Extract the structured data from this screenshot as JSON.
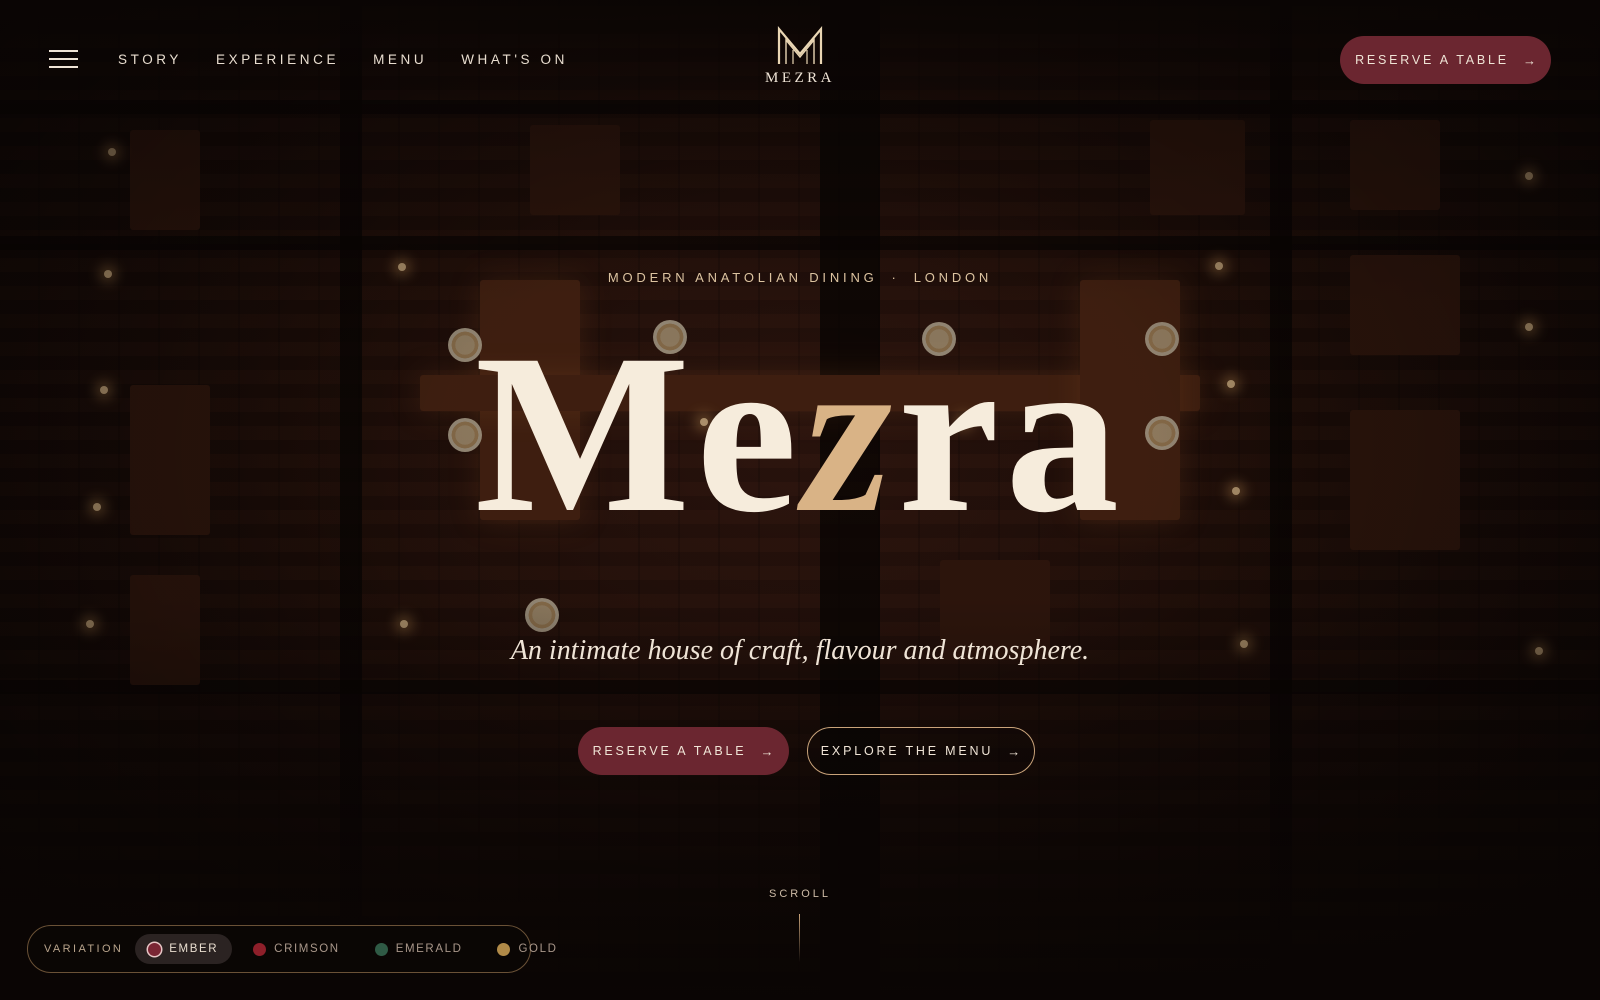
{
  "header": {
    "nav": [
      "STORY",
      "EXPERIENCE",
      "MENU",
      "WHAT'S ON"
    ],
    "brand": "MEZRA",
    "cta_label": "RESERVE A TABLE"
  },
  "hero": {
    "eyebrow_left": "MODERN ANATOLIAN DINING",
    "eyebrow_sep": "·",
    "eyebrow_right": "LONDON",
    "title_part1": "Me",
    "title_accent": "z",
    "title_part2": "ra",
    "tagline": "An intimate house of craft, flavour and atmosphere.",
    "primary_cta": "RESERVE A TABLE",
    "secondary_cta": "EXPLORE THE MENU"
  },
  "scroll": {
    "label": "SCROLL"
  },
  "variation": {
    "label": "VARIATION",
    "options": [
      {
        "name": "EMBER",
        "color": "#7a2634",
        "active": true
      },
      {
        "name": "CRIMSON",
        "color": "#8e1f2a",
        "active": false
      },
      {
        "name": "EMERALD",
        "color": "#2f5a45",
        "active": false
      },
      {
        "name": "GOLD",
        "color": "#b08a48",
        "active": false
      }
    ]
  },
  "colors": {
    "accent_burgundy": "#6b2630",
    "accent_gold": "#d9b386",
    "text_cream": "#f6ecdc",
    "background": "#0c0706"
  },
  "icons": {
    "menu": "hamburger-icon",
    "arrow": "arrow-right-icon",
    "logo": "mezra-monogram-icon"
  }
}
